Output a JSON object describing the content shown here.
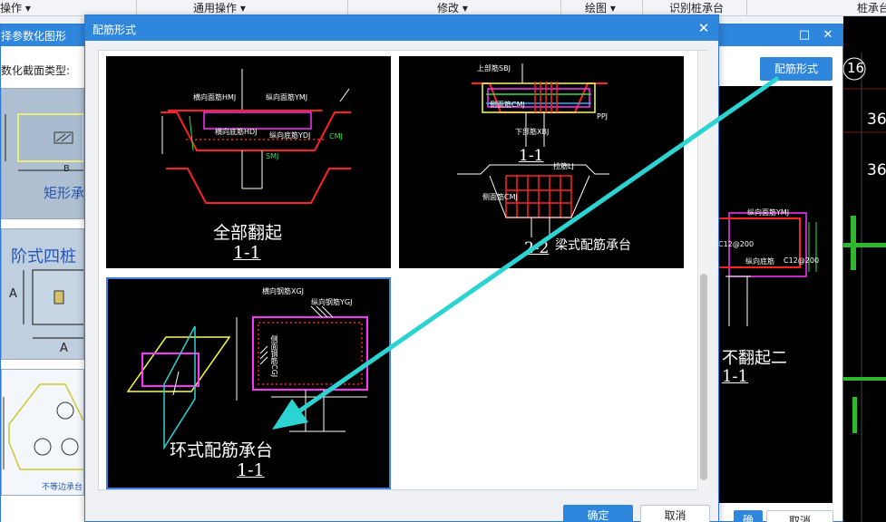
{
  "toolbar": {
    "menus": [
      {
        "label": "操作",
        "has_dropdown": true
      },
      {
        "label": "通用操作",
        "has_dropdown": true
      },
      {
        "label": "修改",
        "has_dropdown": true
      },
      {
        "label": "绘图",
        "has_dropdown": true
      },
      {
        "label": "识别桩承台",
        "has_dropdown": false
      },
      {
        "label": "桩承台",
        "has_dropdown": false
      }
    ]
  },
  "background_window": {
    "title": "择参数化图形",
    "section_type_label": "数化截面类型:",
    "thumbnails": [
      {
        "caption": "矩形承台",
        "dim_b": "B"
      },
      {
        "caption": "阶式四桩",
        "dim_a": "A",
        "dim_a2": "A"
      },
      {
        "caption": "不等边承台"
      }
    ],
    "shape_button": "配筋形式",
    "preview": {
      "lines": [
        "纵向面筋YMJ",
        "C12@200",
        "纵向底筋",
        "C12@200"
      ],
      "caption": "不翻起二",
      "section": "1-1"
    },
    "buttons": {
      "ok": "确",
      "cancel": "取消"
    },
    "right_numbers": [
      "16",
      "36",
      "36"
    ]
  },
  "dialog": {
    "title": "配筋形式",
    "tiles": [
      {
        "caption": "全部翻起",
        "section": "1-1",
        "labels": [
          "横向面筋HMJ",
          "纵向面筋YMJ",
          "横向底筋HDJ",
          "纵向底筋YDJ",
          "CMJ",
          "SMJ"
        ],
        "selected": false
      },
      {
        "caption": "梁式配筋承台",
        "section_top": "1-1",
        "section_bottom": "2-2",
        "labels": [
          "上部筋SBJ",
          "侧面筋CMJ",
          "下部筋XBJ",
          "PPJ",
          "拉筋LJ",
          "侧面筋CMJ"
        ],
        "selected": false
      },
      {
        "caption": "环式配筋承台",
        "section": "1-1",
        "labels": [
          "横向钢筋XGJ",
          "纵向钢筋YGJ",
          "侧面钢筋CGJ"
        ],
        "selected": true
      }
    ],
    "buttons": {
      "ok": "确定",
      "cancel": "取消"
    }
  },
  "colors": {
    "accent": "#2f86dd",
    "tile_bg": "#000000",
    "rebar_red": "#ff2222",
    "rebar_magenta": "#ff33ff",
    "dim_green": "#34e04a",
    "arrow_cyan": "#2cd3d3"
  }
}
